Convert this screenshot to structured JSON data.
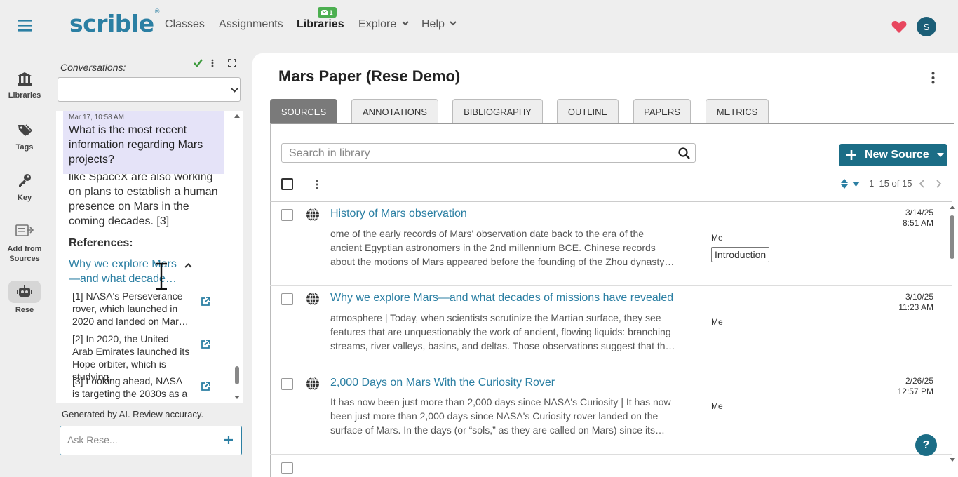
{
  "app": {
    "brand": "scrible",
    "brand_mark": "®"
  },
  "topnav": {
    "classes": "Classes",
    "assignments": "Assignments",
    "assignments_badge": "1",
    "libraries": "Libraries",
    "explore": "Explore",
    "help": "Help",
    "avatar_initial": "S"
  },
  "leftnav": {
    "libraries": "Libraries",
    "tags": "Tags",
    "key": "Key",
    "add_from_sources": "Add from Sources",
    "rese": "Rese"
  },
  "conversation": {
    "label": "Conversations:",
    "select_value": "",
    "message_timestamp": "Mar 17, 10:58 AM",
    "question": "What is the most recent information regarding Mars projects?",
    "answer_tail": "like SpaceX are also working on plans to establish a human presence on Mars in the coming decades. [3]",
    "references_heading": "References:",
    "ref_source_link": "Why we explore Mars—and what decade…",
    "refs": [
      {
        "text": "[1] NASA's Perseverance rover, which launched in 2020 and landed on Mar…"
      },
      {
        "text": "[2] In 2020, the United Arab Emirates launched its Hope orbiter, which is studying…"
      },
      {
        "text": "[3] Looking ahead, NASA is targeting the 2030s as a"
      }
    ],
    "generated_note": "Generated by AI. Review accuracy.",
    "ask_placeholder": "Ask Rese..."
  },
  "main": {
    "title": "Mars Paper (Rese Demo)",
    "tabs": [
      "SOURCES",
      "ANNOTATIONS",
      "BIBLIOGRAPHY",
      "OUTLINE",
      "PAPERS",
      "METRICS"
    ],
    "active_tab": "SOURCES",
    "search_placeholder": "Search in library",
    "new_source_label": "New Source",
    "pager": "1–15 of 15",
    "sources": [
      {
        "title": "History of Mars observation",
        "desc": "ome of the early records of Mars' observation date back to the era of the ancient Egyptian astronomers in the 2nd millennium BCE. Chinese records about the motions of Mars appeared before the founding of the Zhou dynasty…",
        "owner": "Me",
        "tag": "Introduction",
        "date": "3/14/25",
        "time": "8:51 AM"
      },
      {
        "title": "Why we explore Mars—and what decades of missions have revealed",
        "desc": "atmosphere | Today, when scientists scrutinize the Martian surface, they see features that are unquestionably the work of ancient, flowing liquids: branching streams, river valleys, basins, and deltas. Those observations suggest that th…",
        "owner": "Me",
        "tag": "",
        "date": "3/10/25",
        "time": "11:23 AM"
      },
      {
        "title": "2,000 Days on Mars With the Curiosity Rover",
        "desc": "It has now been just more than 2,000 days since NASA's Curiosity | It has now been just more than 2,000 days since NASA's Curiosity rover landed on the surface of Mars. In the days (or “sols,” as they are called on Mars) since its…",
        "owner": "Me",
        "tag": "",
        "date": "2/26/25",
        "time": "12:57 PM"
      }
    ],
    "help_label": "?"
  },
  "colors": {
    "accent": "#2b7fa3",
    "primary_button": "#1b6d86",
    "bubble": "#e5e3f8",
    "heart": "#e8475f",
    "badge": "#4caf50"
  },
  "icons": [
    "menu-icon",
    "libraries-icon",
    "tags-icon",
    "key-icon",
    "add-from-sources-icon",
    "robot-icon",
    "heart-icon",
    "globe-icon",
    "external-link-icon",
    "search-icon",
    "plus-icon",
    "sort-icon",
    "kebab-icon",
    "expand-icon",
    "check-icon"
  ]
}
